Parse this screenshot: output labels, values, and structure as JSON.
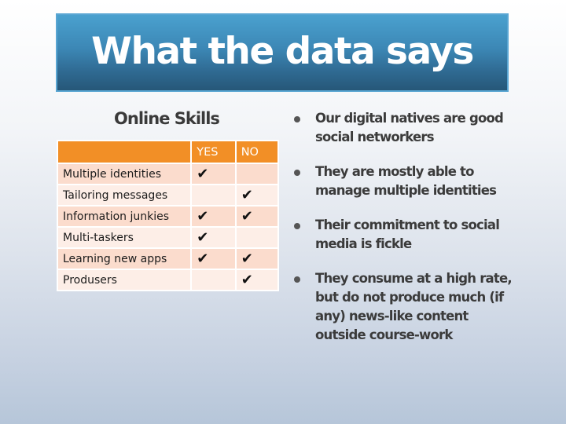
{
  "slide": {
    "title": "What the data says"
  },
  "table": {
    "title": "Online Skills",
    "columns": [
      "",
      "YES",
      "NO"
    ],
    "check_glyph": "✔",
    "rows": [
      {
        "label": "Multiple identities",
        "yes": "✔",
        "no": ""
      },
      {
        "label": "Tailoring messages",
        "yes": "",
        "no": "✔"
      },
      {
        "label": "Information junkies",
        "yes": "✔",
        "no": "✔"
      },
      {
        "label": "Multi-taskers",
        "yes": "✔",
        "no": ""
      },
      {
        "label": "Learning new apps",
        "yes": "✔",
        "no": "✔"
      },
      {
        "label": "Produsers",
        "yes": "",
        "no": "✔"
      }
    ]
  },
  "bullets": [
    {
      "text": "Our digital natives are good social networkers",
      "icon": "bullet-dot-icon"
    },
    {
      "text": "They are mostly able to manage multiple identities",
      "icon": "bullet-dot-icon"
    },
    {
      "text": "Their commitment to social media is fickle",
      "icon": "bullet-dot-icon"
    },
    {
      "text": "They consume at a high rate, but do not produce much (if any) news-like content outside course-work",
      "icon": "bullet-dot-icon"
    }
  ],
  "colors": {
    "title_bar": "#3c87b5",
    "table_header": "#f28f26",
    "row_odd": "#fbdccd",
    "row_even": "#fdeee7"
  }
}
